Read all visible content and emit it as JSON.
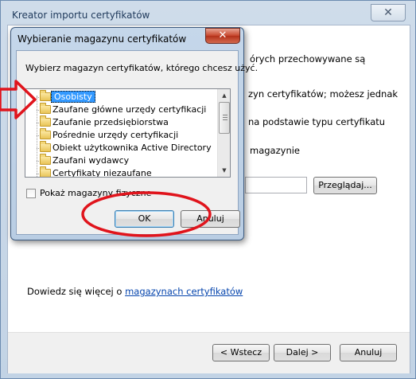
{
  "wizard": {
    "title": "Kreator importu certyfikatów",
    "close_glyph": "✕",
    "text_line1": "órych przechowywane są",
    "text_line2": "zyn certyfikatów; możesz jednak",
    "text_line3": "na podstawie typu certyfikatu",
    "text_line4": "magazynie",
    "browse_label": "Przeglądaj...",
    "learn_more_prefix": "Dowiedz się więcej o",
    "learn_more_link": "magazynach certyfikatów",
    "back_label": "< Wstecz",
    "next_label": "Dalej >",
    "cancel_label": "Anuluj"
  },
  "dialog": {
    "title": "Wybieranie magazynu certyfikatów",
    "close_glyph": "✕",
    "prompt": "Wybierz magazyn certyfikatów, którego chcesz użyć.",
    "stores": [
      {
        "label": "Osobisty",
        "selected": true
      },
      {
        "label": "Zaufane główne urzędy certyfikacji"
      },
      {
        "label": "Zaufanie przedsiębiorstwa"
      },
      {
        "label": "Pośrednie urzędy certyfikacji"
      },
      {
        "label": "Obiekt użytkownika Active Directory"
      },
      {
        "label": "Zaufani wydawcy"
      },
      {
        "label": "Certyfikaty niezaufane"
      }
    ],
    "show_physical_label": "Pokaż magazyny fizyczne",
    "ok_label": "OK",
    "cancel_label": "Anuluj"
  },
  "colors": {
    "annotation_red": "#e0141c",
    "selection_blue": "#3399ff",
    "link_blue": "#0645ad"
  }
}
